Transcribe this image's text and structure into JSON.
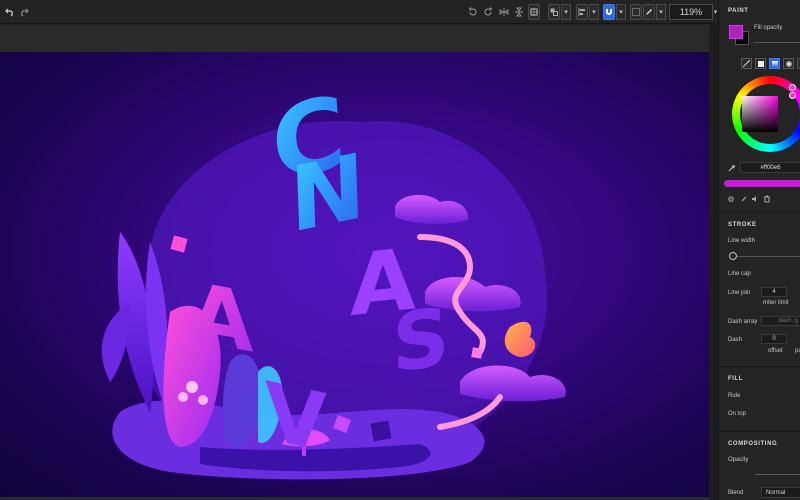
{
  "toolbar": {
    "undo_icon": "undo-icon",
    "redo_icon": "redo-icon",
    "zoom_value": "119%"
  },
  "panel": {
    "paint_title": "PAINT",
    "fill_opacity_label": "Fill opacity",
    "hex_value": "#ff00e6",
    "stroke_title": "STROKE",
    "line_width_label": "Line width",
    "line_cap_label": "Line cap",
    "line_join_label": "Line join",
    "line_join_value": "4",
    "miter_limit_label": "miter limit",
    "dash_array_label": "Dash array",
    "dash_array_placeholder": "dash, g",
    "dash_label": "Dash",
    "dash_value": "0",
    "offset_label": "offset",
    "pattern_label": "pa",
    "fill_title": "FILL",
    "rule_label": "Rule",
    "on_top_label": "On top",
    "compositing_title": "COMPOSITING",
    "opacity_label": "Opacity",
    "blend_label": "Blend",
    "blend_value": "Normal"
  },
  "artwork": {
    "letters": [
      "C",
      "A",
      "N",
      "V",
      "A",
      "S"
    ]
  },
  "colors": {
    "accent_blue": "#2e6ad8",
    "fill_color": "#ff00e6",
    "canvas_bg": "#33077e"
  }
}
